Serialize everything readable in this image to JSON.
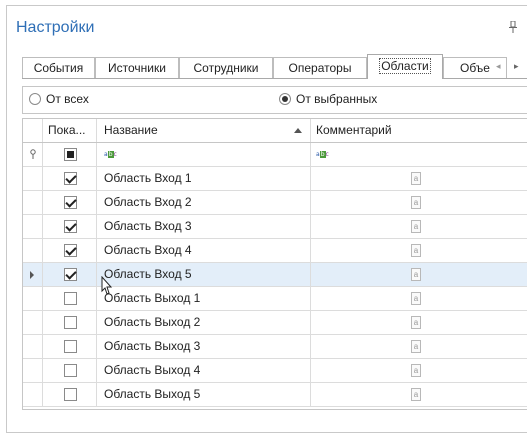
{
  "header": {
    "title": "Настройки"
  },
  "tabs": [
    {
      "label": "События",
      "active": false
    },
    {
      "label": "Источники",
      "active": false
    },
    {
      "label": "Сотрудники",
      "active": false
    },
    {
      "label": "Операторы",
      "active": false
    },
    {
      "label": "Области",
      "active": true
    },
    {
      "label": "Объе",
      "active": false
    }
  ],
  "tab_scroll": {
    "left": "◂",
    "right": "▸"
  },
  "mode": {
    "options": [
      "От всех",
      "От выбранных"
    ],
    "selected": "От выбранных"
  },
  "grid": {
    "columns": {
      "show": "Пока...",
      "name": "Название",
      "comment": "Комментарий"
    },
    "sorted_column": "name",
    "filter_row": {
      "show_state": "indeterminate",
      "abc_a": "a",
      "abc_b": "b",
      "abc_c": "c"
    },
    "focused_row": 4,
    "rows": [
      {
        "checked": true,
        "name": "Область Вход 1",
        "comment": ""
      },
      {
        "checked": true,
        "name": "Область Вход 2",
        "comment": ""
      },
      {
        "checked": true,
        "name": "Область Вход 3",
        "comment": ""
      },
      {
        "checked": true,
        "name": "Область Вход 4",
        "comment": ""
      },
      {
        "checked": true,
        "name": "Область Вход 5",
        "comment": ""
      },
      {
        "checked": false,
        "name": "Область Выход 1",
        "comment": ""
      },
      {
        "checked": false,
        "name": "Область Выход 2",
        "comment": ""
      },
      {
        "checked": false,
        "name": "Область Выход 3",
        "comment": ""
      },
      {
        "checked": false,
        "name": "Область Выход 4",
        "comment": ""
      },
      {
        "checked": false,
        "name": "Область Выход 5",
        "comment": ""
      }
    ],
    "memo_glyph": "a"
  },
  "colors": {
    "title": "#2f6fb6",
    "focused_row": "#e3eef9"
  }
}
